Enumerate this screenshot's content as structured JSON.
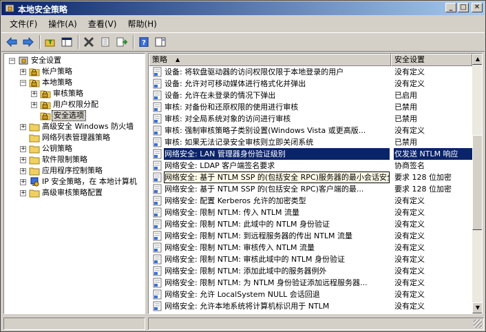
{
  "window": {
    "title": "本地安全策略"
  },
  "menu": [
    "文件(F)",
    "操作(A)",
    "查看(V)",
    "帮助(H)"
  ],
  "tree": [
    {
      "label": "安全设置",
      "level": 0,
      "exp": "-",
      "icon": "security-icon"
    },
    {
      "label": "帐户策略",
      "level": 1,
      "exp": "+",
      "icon": "folder-lock-icon"
    },
    {
      "label": "本地策略",
      "level": 1,
      "exp": "-",
      "icon": "folder-lock-icon"
    },
    {
      "label": "审核策略",
      "level": 2,
      "exp": "+",
      "icon": "folder-lock-icon"
    },
    {
      "label": "用户权限分配",
      "level": 2,
      "exp": "+",
      "icon": "folder-lock-icon"
    },
    {
      "label": "安全选项",
      "level": 2,
      "exp": "",
      "icon": "folder-lock-icon",
      "selected": true
    },
    {
      "label": "高级安全 Windows 防火墙",
      "level": 1,
      "exp": "+",
      "icon": "folder-icon"
    },
    {
      "label": "网络列表管理器策略",
      "level": 1,
      "exp": "",
      "icon": "folder-icon"
    },
    {
      "label": "公钥策略",
      "level": 1,
      "exp": "+",
      "icon": "folder-icon"
    },
    {
      "label": "软件限制策略",
      "level": 1,
      "exp": "+",
      "icon": "folder-icon"
    },
    {
      "label": "应用程序控制策略",
      "level": 1,
      "exp": "+",
      "icon": "folder-icon"
    },
    {
      "label": "IP 安全策略，在 本地计算机",
      "level": 1,
      "exp": "+",
      "icon": "ip-security-icon"
    },
    {
      "label": "高级审核策略配置",
      "level": 1,
      "exp": "+",
      "icon": "folder-icon"
    }
  ],
  "columns": {
    "policy": "策略",
    "setting": "安全设置"
  },
  "rows": [
    {
      "policy": "设备: 将软盘驱动器的访问权限仅限于本地登录的用户",
      "setting": "没有定义"
    },
    {
      "policy": "设备: 允许对可移动媒体进行格式化并弹出",
      "setting": "没有定义"
    },
    {
      "policy": "设备: 允许在未登录的情况下弹出",
      "setting": "已启用"
    },
    {
      "policy": "审核: 对备份和还原权限的使用进行审核",
      "setting": "已禁用"
    },
    {
      "policy": "审核: 对全局系统对象的访问进行审核",
      "setting": "已禁用"
    },
    {
      "policy": "审核: 强制审核策略子类别设置(Windows Vista 或更高版...",
      "setting": "没有定义"
    },
    {
      "policy": "审核: 如果无法记录安全审核则立即关闭系统",
      "setting": "已禁用"
    },
    {
      "policy": "网络安全: LAN 管理器身份验证级别",
      "setting": "仅发送 NTLM 响应",
      "selected": true
    },
    {
      "policy": "网络安全: LDAP 客户端签名要求",
      "setting": "协商签名"
    },
    {
      "policy": "网络安全: 基于 NTLM SSP 的(包括安全 RPC)服务器的最小会话安全",
      "setting": "要求 128 位加密",
      "focus": true
    },
    {
      "policy": "网络安全: 基于 NTLM SSP 的(包括安全 RPC)客户端的最...",
      "setting": "要求 128 位加密"
    },
    {
      "policy": "网络安全: 配置 Kerberos 允许的加密类型",
      "setting": "没有定义"
    },
    {
      "policy": "网络安全: 限制 NTLM: 传入 NTLM 流量",
      "setting": "没有定义"
    },
    {
      "policy": "网络安全: 限制 NTLM: 此域中的 NTLM 身份验证",
      "setting": "没有定义"
    },
    {
      "policy": "网络安全: 限制 NTLM: 到远程服务器的传出 NTLM 流量",
      "setting": "没有定义"
    },
    {
      "policy": "网络安全: 限制 NTLM: 审核传入 NTLM 流量",
      "setting": "没有定义"
    },
    {
      "policy": "网络安全: 限制 NTLM: 审核此域中的 NTLM 身份验证",
      "setting": "没有定义"
    },
    {
      "policy": "网络安全: 限制 NTLM: 添加此域中的服务器例外",
      "setting": "没有定义"
    },
    {
      "policy": "网络安全: 限制 NTLM: 为 NTLM 身份验证添加远程服务器...",
      "setting": "没有定义"
    },
    {
      "policy": "网络安全: 允许 LocalSystem NULL 会话回退",
      "setting": "没有定义"
    },
    {
      "policy": "网络安全: 允许本地系统将计算机标识用于 NTLM",
      "setting": "没有定义"
    }
  ],
  "colors": {
    "title_start": "#0a246a",
    "title_end": "#a6caf0",
    "selection": "#0a246a"
  }
}
